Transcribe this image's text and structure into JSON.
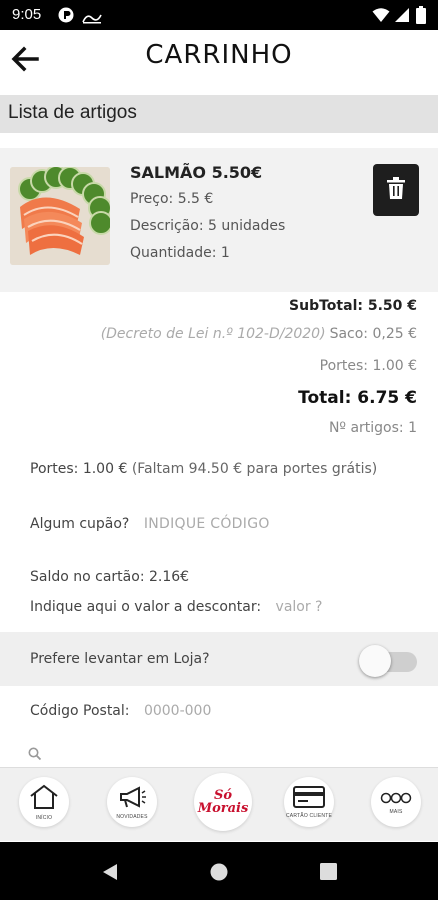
{
  "status_bar": {
    "time": "9:05",
    "icons": [
      "app-notification-icon",
      "app-notification-icon-2",
      "wifi-icon",
      "signal-icon",
      "battery-icon"
    ]
  },
  "header": {
    "back_icon": "arrow-left-icon",
    "title": "CARRINHO"
  },
  "items_section": {
    "title": "Lista de artigos"
  },
  "cart_items": [
    {
      "name": "SALMÃO 5.50€",
      "price": "Preço: 5.5 €",
      "description": "Descrição: 5 unidades",
      "quantity": "Quantidade: 1",
      "delete_icon": "trash-icon"
    }
  ],
  "totals": {
    "subtotal": "SubTotal: 5.50 €",
    "decree": "(Decreto de Lei n.º 102-D/2020)",
    "bag": "Saco: 0,25 €",
    "shipping": "Portes: 1.00 €",
    "total": "Total: 6.75 €",
    "item_count": "Nº artigos: 1"
  },
  "shipping_note": {
    "label": "Portes: 1.00 €",
    "remaining": "(Faltam 94.50 € para portes grátis)"
  },
  "coupon": {
    "label": "Algum cupão?",
    "placeholder": "INDIQUE CÓDIGO"
  },
  "card_balance": {
    "label": "Saldo no cartão: 2.16€"
  },
  "discount": {
    "label": "Indique aqui o valor a descontar:",
    "placeholder": "valor ?"
  },
  "pickup": {
    "label": "Prefere levantar em Loja?",
    "enabled": false
  },
  "postal_code": {
    "label": "Código Postal:",
    "placeholder": "0000-000"
  },
  "bottom_nav": {
    "items": [
      {
        "label": "INÍCIO",
        "icon": "home-icon"
      },
      {
        "label": "NOVIDADES",
        "icon": "megaphone-icon"
      },
      {
        "label": "Só Morais",
        "icon": "brand-logo"
      },
      {
        "label": "CARTÃO CLIENTE",
        "icon": "card-icon"
      },
      {
        "label": "MAIS",
        "icon": "more-icon"
      }
    ]
  },
  "colors": {
    "accent_dark": "#1e1e1e",
    "section_bg": "#e2e2e2",
    "card_bg": "#f2f2f2",
    "brand_red": "#c8102e"
  }
}
